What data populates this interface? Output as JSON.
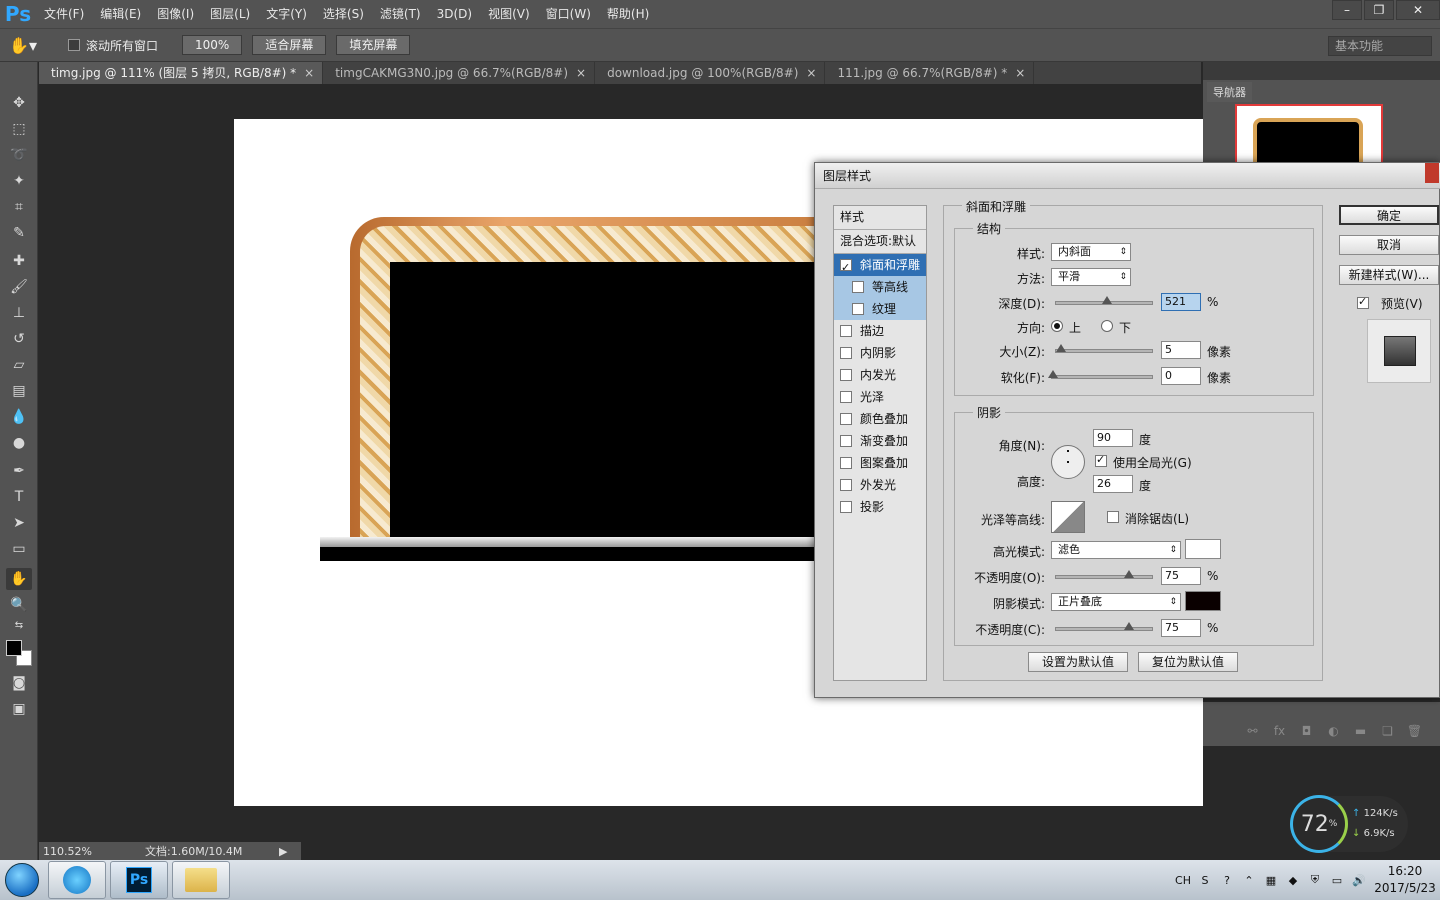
{
  "app": {
    "logo": "Ps",
    "menu": [
      "文件(F)",
      "编辑(E)",
      "图像(I)",
      "图层(L)",
      "文字(Y)",
      "选择(S)",
      "滤镜(T)",
      "3D(D)",
      "视图(V)",
      "窗口(W)",
      "帮助(H)"
    ]
  },
  "options": {
    "scroll_all_label": "滚动所有窗口",
    "zoom_100": "100%",
    "fit_screen": "适合屏幕",
    "fill_screen": "填充屏幕",
    "workspace": "基本功能"
  },
  "tabs": [
    {
      "label": "timg.jpg @ 111% (图层 5 拷贝, RGB/8#) *",
      "active": true
    },
    {
      "label": "timgCAKMG3N0.jpg @ 66.7%(RGB/8#)",
      "active": false
    },
    {
      "label": "download.jpg @ 100%(RGB/8#)",
      "active": false
    },
    {
      "label": "111.jpg @ 66.7%(RGB/8#) *",
      "active": false
    }
  ],
  "status": {
    "zoom": "110.52%",
    "doc": "文档:1.60M/10.4M"
  },
  "navigator": {
    "title": "导航器"
  },
  "dialog": {
    "title": "图层样式",
    "style_list": {
      "header": "样式",
      "blend": "混合选项:默认",
      "items": [
        {
          "label": "斜面和浮雕",
          "checked": true,
          "selected": true,
          "sub": false
        },
        {
          "label": "等高线",
          "checked": false,
          "selected": false,
          "sub": true
        },
        {
          "label": "纹理",
          "checked": false,
          "selected": false,
          "sub": true
        },
        {
          "label": "描边",
          "checked": false,
          "selected": false,
          "sub": false
        },
        {
          "label": "内阴影",
          "checked": false,
          "selected": false,
          "sub": false
        },
        {
          "label": "内发光",
          "checked": false,
          "selected": false,
          "sub": false
        },
        {
          "label": "光泽",
          "checked": false,
          "selected": false,
          "sub": false
        },
        {
          "label": "颜色叠加",
          "checked": false,
          "selected": false,
          "sub": false
        },
        {
          "label": "渐变叠加",
          "checked": false,
          "selected": false,
          "sub": false
        },
        {
          "label": "图案叠加",
          "checked": false,
          "selected": false,
          "sub": false
        },
        {
          "label": "外发光",
          "checked": false,
          "selected": false,
          "sub": false
        },
        {
          "label": "投影",
          "checked": false,
          "selected": false,
          "sub": false
        }
      ]
    },
    "bevel": {
      "section": "斜面和浮雕",
      "structure": "结构",
      "style_label": "样式:",
      "style_value": "内斜面",
      "technique_label": "方法:",
      "technique_value": "平滑",
      "depth_label": "深度(D):",
      "depth_value": "521",
      "depth_unit": "%",
      "direction_label": "方向:",
      "dir_up": "上",
      "dir_down": "下",
      "size_label": "大小(Z):",
      "size_value": "5",
      "size_unit": "像素",
      "soften_label": "软化(F):",
      "soften_value": "0",
      "soften_unit": "像素"
    },
    "shading": {
      "section": "阴影",
      "angle_label": "角度(N):",
      "angle_value": "90",
      "angle_unit": "度",
      "global_light": "使用全局光(G)",
      "altitude_label": "高度:",
      "altitude_value": "26",
      "altitude_unit": "度",
      "gloss_label": "光泽等高线:",
      "anti_alias": "消除锯齿(L)",
      "highlight_label": "高光模式:",
      "highlight_value": "滤色",
      "highlight_opacity_label": "不透明度(O):",
      "highlight_opacity": "75",
      "shadow_label": "阴影模式:",
      "shadow_value": "正片叠底",
      "shadow_opacity_label": "不透明度(C):",
      "shadow_opacity": "75",
      "pct": "%",
      "highlight_color": "#ffffff",
      "shadow_color": "#0a0000"
    },
    "buttons": {
      "set_default": "设置为默认值",
      "reset_default": "复位为默认值",
      "ok": "确定",
      "cancel": "取消",
      "new_style": "新建样式(W)...",
      "preview": "预览(V)"
    }
  },
  "network": {
    "percent": "72",
    "percent_unit": "%",
    "up": "124K/s",
    "down": "6.9K/s"
  },
  "tray": {
    "lang": "CH",
    "time": "16:20",
    "date": "2017/5/23"
  }
}
